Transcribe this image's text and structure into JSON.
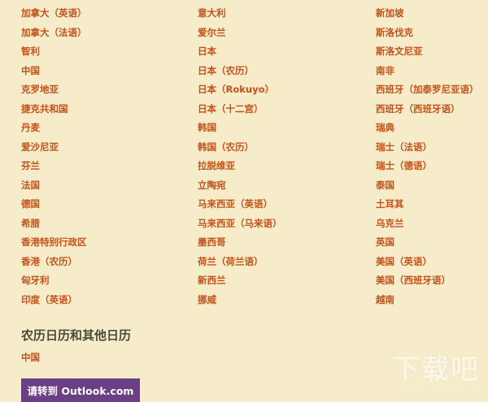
{
  "countries": {
    "col1": [
      "加拿大（英语）",
      "加拿大（法语）",
      "智利",
      "中国",
      "克罗地亚",
      "捷克共和国",
      "丹麦",
      "爱沙尼亚",
      "芬兰",
      "法国",
      "德国",
      "希腊",
      "香港特别行政区",
      "香港（农历）",
      "匈牙利",
      "印度（英语）"
    ],
    "col2": [
      "意大利",
      "爱尔兰",
      "日本",
      "日本（农历）",
      "日本（Rokuyo）",
      "日本（十二宫）",
      "韩国",
      "韩国（农历）",
      "拉脱维亚",
      "立陶宛",
      "马来西亚（英语）",
      "马来西亚（马来语）",
      "墨西哥",
      "荷兰（荷兰语）",
      "新西兰",
      "挪威"
    ],
    "col3": [
      "新加坡",
      "斯洛伐克",
      "斯洛文尼亚",
      "南非",
      "西班牙（加泰罗尼亚语）",
      "西班牙（西班牙语）",
      "瑞典",
      "瑞士（法语）",
      "瑞士（德语）",
      "泰国",
      "土耳其",
      "乌克兰",
      "英国",
      "美国（英语）",
      "美国（西班牙语）",
      "越南"
    ]
  },
  "section": {
    "title": "农历日历和其他日历",
    "link": "中国"
  },
  "cta": {
    "label": "请转到 Outlook.com"
  },
  "watermark": {
    "mark": "下载吧",
    "url": "www.xiazaiba.com"
  },
  "colors": {
    "background": "#f6ecca",
    "link": "#c3531a",
    "heading": "#4b4a3a",
    "button": "#6b3f86"
  }
}
